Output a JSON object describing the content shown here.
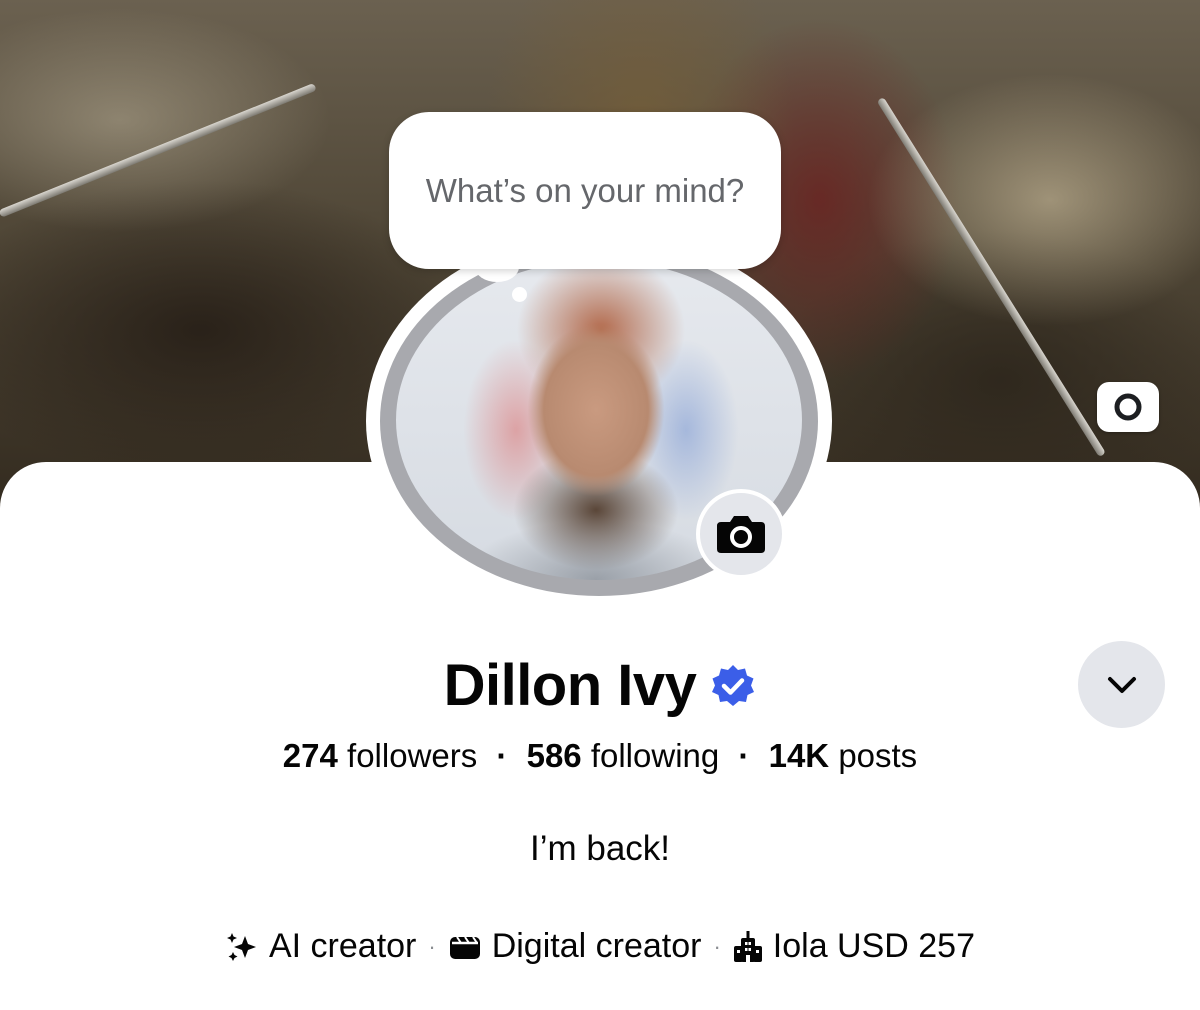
{
  "composer": {
    "placeholder": "What’s on your mind?"
  },
  "profile": {
    "name": "Dillon Ivy",
    "verified": true,
    "followers": "274",
    "followers_label": "followers",
    "following": "586",
    "following_label": "following",
    "posts": "14K",
    "posts_label": "posts",
    "bio": "I’m back!"
  },
  "details": [
    {
      "icon": "sparkle-icon",
      "label": "AI creator"
    },
    {
      "icon": "clapperboard-icon",
      "label": "Digital creator"
    },
    {
      "icon": "building-icon",
      "label": "Iola USD 257"
    }
  ],
  "colors": {
    "verified_badge": "#3b5ee8",
    "secondary_text": "#65676b",
    "button_bg": "#e4e6eb"
  }
}
